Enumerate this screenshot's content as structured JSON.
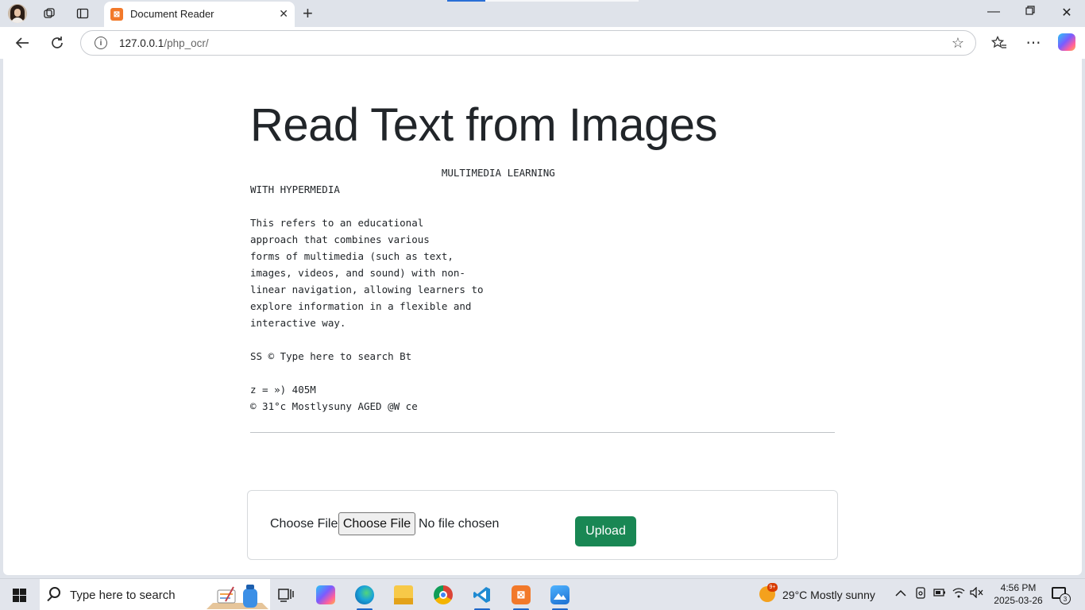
{
  "browser": {
    "tab_title": "Document Reader",
    "tab_favicon_glyph": "⊠",
    "url_host": "127.0.0.1",
    "url_path": "/php_ocr/"
  },
  "page": {
    "title": "Read Text from Images",
    "ocr_text": "                                MULTIMEDIA LEARNING\nWITH HYPERMEDIA\n\nThis refers to an educational\napproach that combines various\nforms of multimedia (such as text,\nimages, videos, and sound) with non-\nlinear navigation, allowing learners to\nexplore information in a flexible and\ninteractive way.\n\nSS © Type here to search Bt\n\nz = ») 405M\n© 31°c Mostlysuny AGED @W ce",
    "file_label": "Choose File",
    "file_button": "Choose File",
    "file_status": "No file chosen",
    "upload_button": "Upload"
  },
  "taskbar": {
    "search_placeholder": "Type here to search",
    "weather_badge": "9+",
    "weather_text": "29°C  Mostly sunny",
    "time": "4:56 PM",
    "date": "2025-03-26",
    "notification_count": "3"
  },
  "colors": {
    "upload_button": "#198754",
    "tab_favicon": "#f2792a",
    "active_indicator": "#1e66c8"
  }
}
